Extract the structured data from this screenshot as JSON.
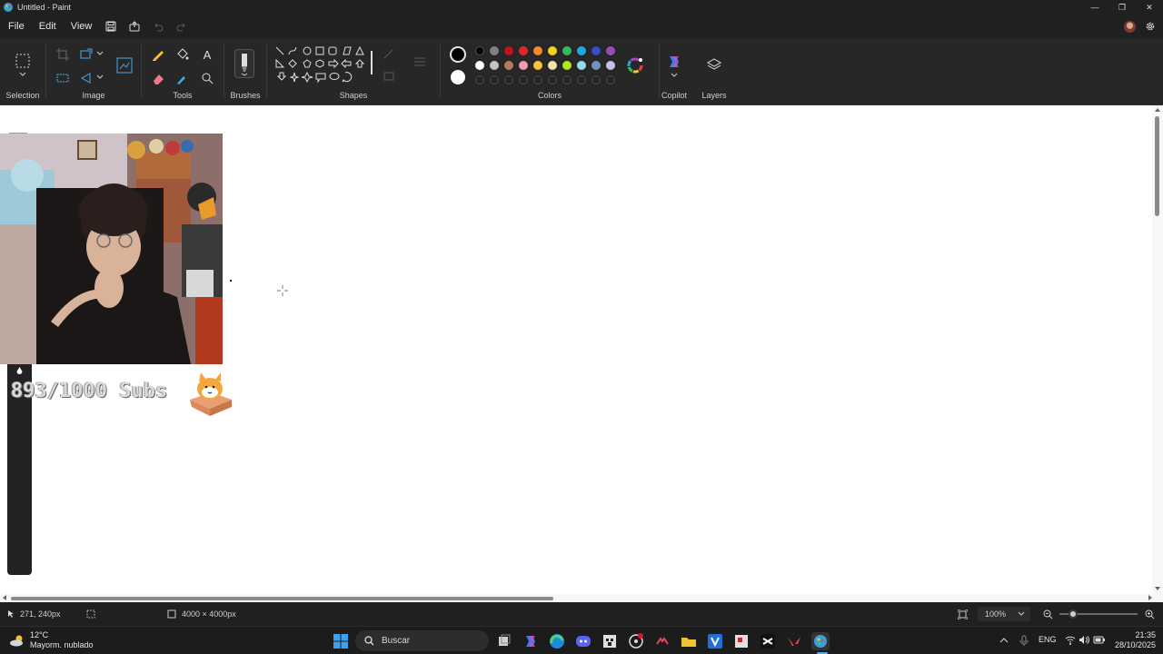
{
  "window": {
    "title": "Untitled - Paint",
    "minimize": "—",
    "maximize": "❐",
    "close": "✕"
  },
  "menu": {
    "file": "File",
    "edit": "Edit",
    "view": "View"
  },
  "ribbon": {
    "groups": {
      "selection": "Selection",
      "image": "Image",
      "tools": "Tools",
      "brushes": "Brushes",
      "shapes": "Shapes",
      "colors": "Colors",
      "copilot": "Copilot",
      "layers": "Layers"
    },
    "primary_color": "#000000",
    "secondary_color": "#ffffff",
    "palette_row1": [
      "#000000",
      "#7f7f7f",
      "#c1121f",
      "#e3262e",
      "#f58a28",
      "#f2d31b",
      "#2ebd59",
      "#1ea7e0",
      "#3c4cc8",
      "#9a4bb5"
    ],
    "palette_row2": [
      "#ffffff",
      "#c3c3c3",
      "#b97a57",
      "#f29ab2",
      "#f9c23c",
      "#efe4a6",
      "#b5e61d",
      "#99d9ea",
      "#7092be",
      "#c8bfe7"
    ]
  },
  "canvas": {
    "overlay_text": "893/1000 Subs"
  },
  "status": {
    "cursor_position": "271, 240px",
    "canvas_size": "4000 × 4000px",
    "zoom": "100%"
  },
  "taskbar": {
    "weather_temp": "12°C",
    "weather_desc": "Mayorm. nublado",
    "search_placeholder": "Buscar",
    "language": "ENG",
    "time": "21:35",
    "date": "28/10/2025"
  }
}
